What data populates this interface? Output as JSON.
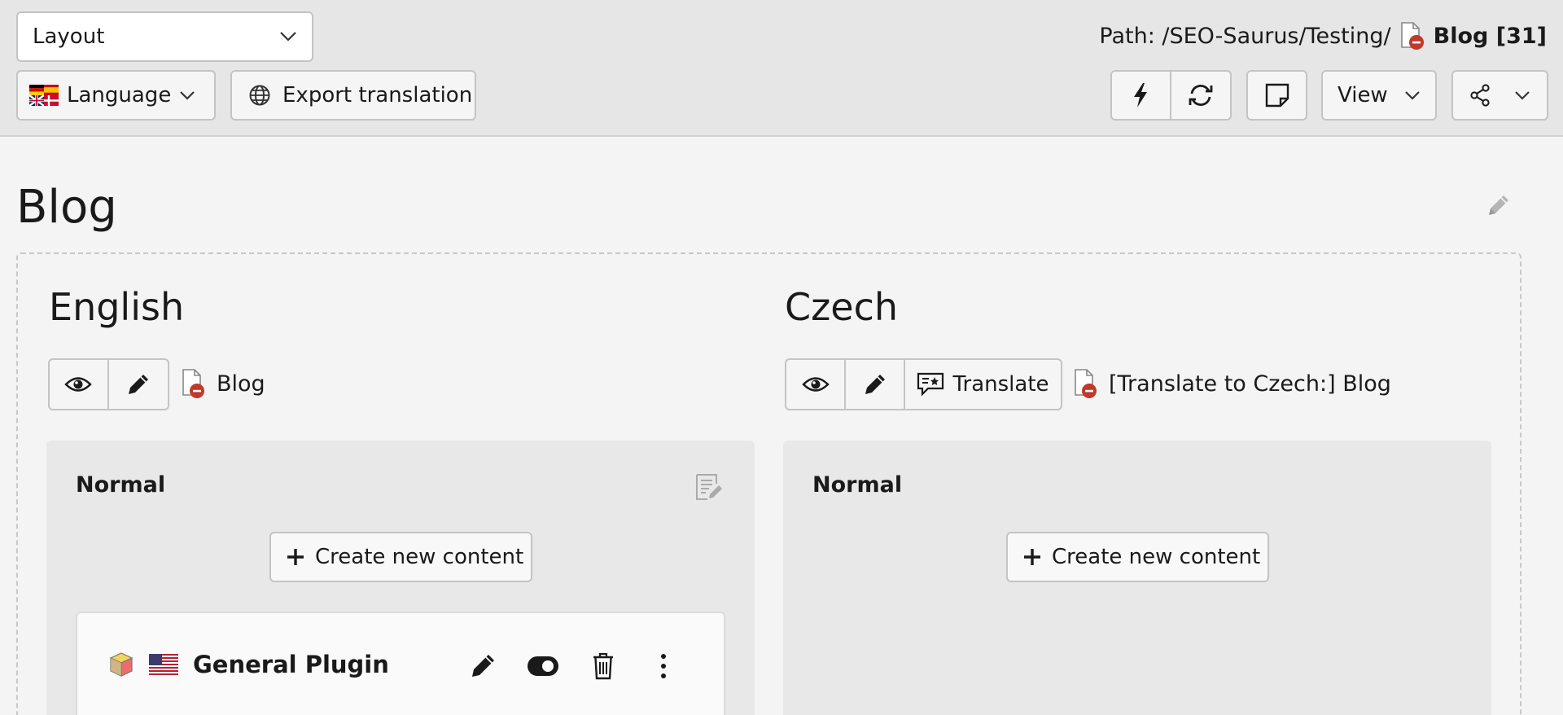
{
  "toolbar": {
    "layout_select": {
      "value": "Layout"
    },
    "language_button": {
      "label": "Language"
    },
    "export_button": {
      "label": "Export translation"
    },
    "path": {
      "prefix": "Path: /SEO-Saurus/Testing/",
      "page": "Blog [31]"
    },
    "view_button": {
      "label": "View"
    }
  },
  "page": {
    "title": "Blog"
  },
  "columns": {
    "english": {
      "title": "English",
      "page_ref": "Blog",
      "panel_title": "Normal",
      "create_button": "Create new content",
      "card": {
        "title": "General Plugin"
      }
    },
    "czech": {
      "title": "Czech",
      "translate_button": "Translate",
      "page_ref": "[Translate to Czech:] Blog",
      "panel_title": "Normal",
      "create_button": "Create new content"
    }
  },
  "icons": {
    "layout_chevron": "chevron-down-icon",
    "flag_multi": "flags-icon",
    "globe": "globe-icon",
    "page_hidden": "page-hidden-icon",
    "flash": "bolt-icon",
    "refresh": "refresh-icon",
    "note": "note-icon",
    "share": "share-icon",
    "pencil": "pencil-icon",
    "eye": "eye-icon",
    "translate": "translate-icon",
    "plus": "plus-icon",
    "cube": "cube-icon",
    "flag_us": "flag-us-icon",
    "toggle": "toggle-icon",
    "trash": "trash-icon",
    "more": "more-vertical-icon",
    "panel_edit": "edit-column-icon"
  },
  "colors": {
    "topbar_bg": "#e6e6e6",
    "page_bg": "#f4f4f4",
    "panel_bg": "#e8e8e8",
    "hidden_badge": "#c0392b"
  }
}
